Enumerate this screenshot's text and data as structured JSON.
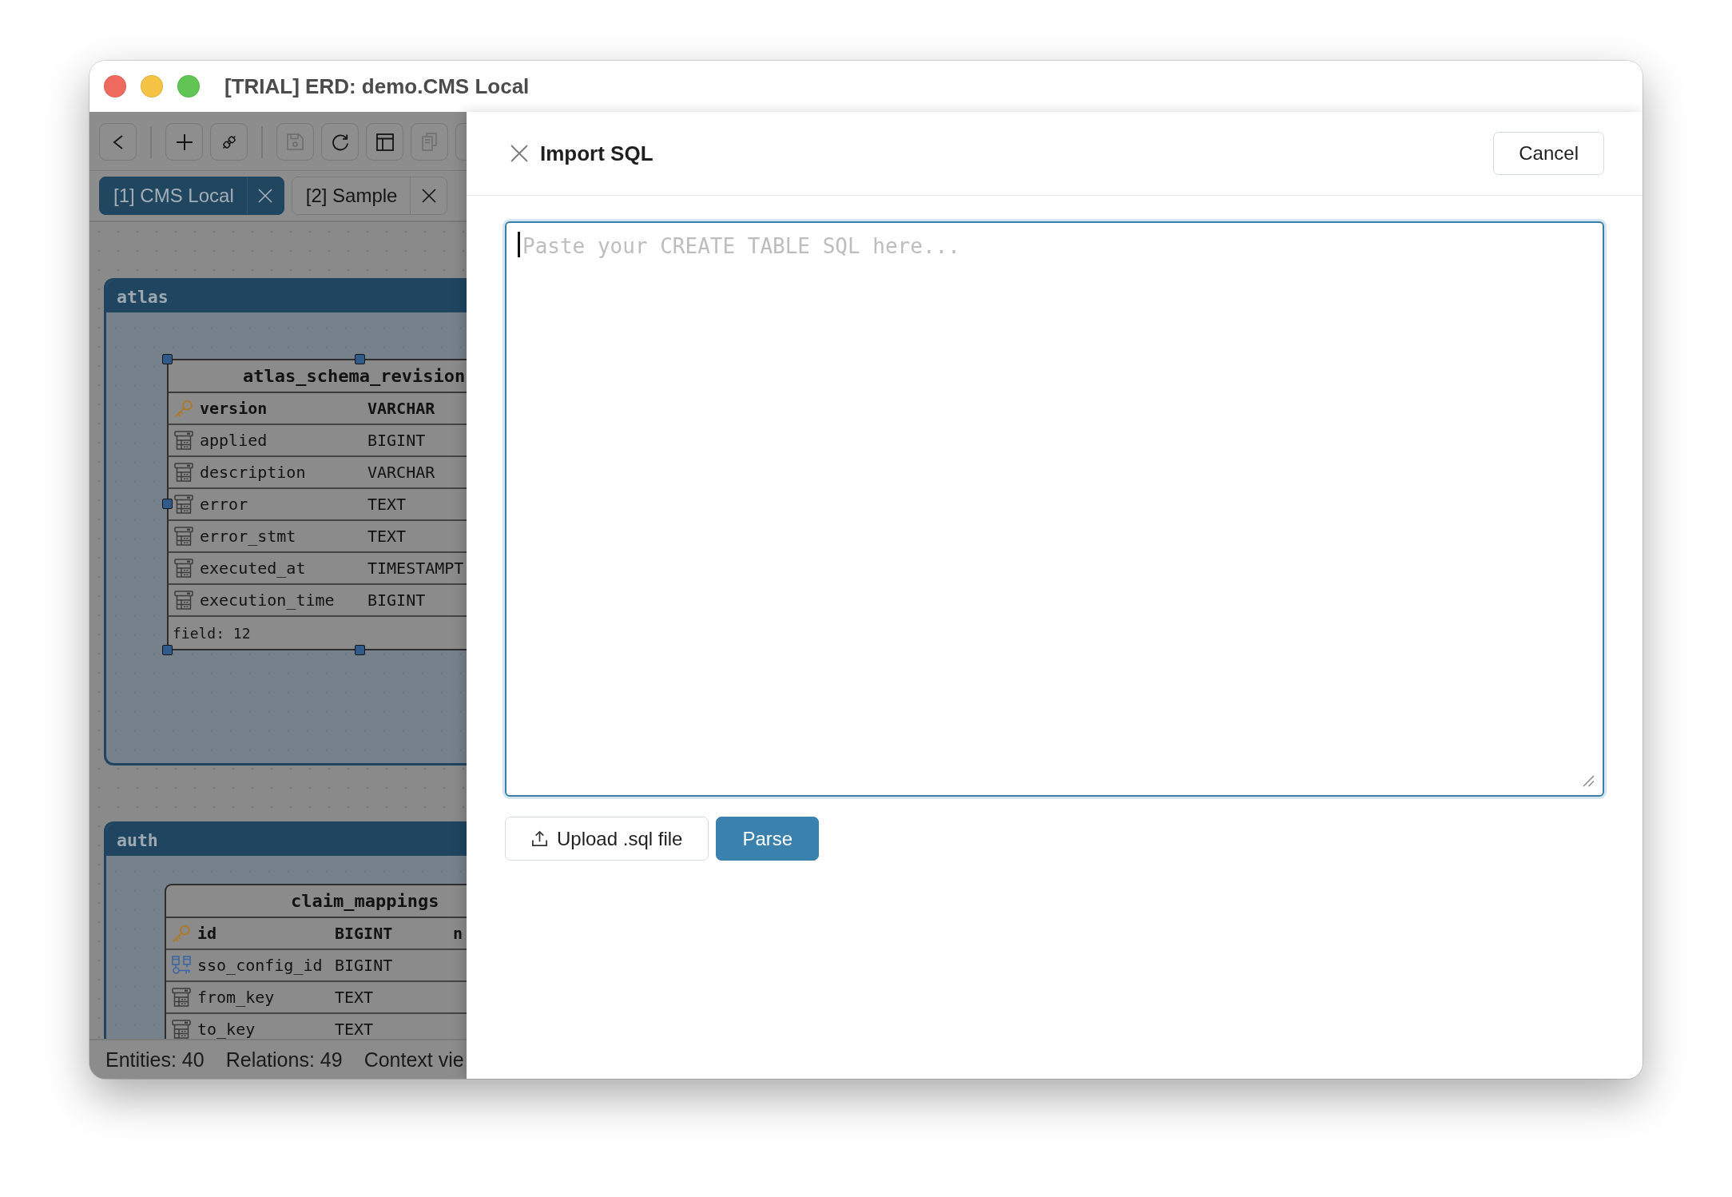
{
  "window": {
    "title": "[TRIAL] ERD: demo.CMS Local"
  },
  "toolbar": {
    "groups": [
      {
        "items": [
          {
            "kind": "back",
            "disabled": false
          }
        ]
      },
      {
        "items": [
          {
            "kind": "add",
            "disabled": false
          },
          {
            "kind": "connect",
            "disabled": false
          }
        ]
      },
      {
        "items": [
          {
            "kind": "save",
            "disabled": true
          },
          {
            "kind": "refresh",
            "disabled": false
          },
          {
            "kind": "layout",
            "disabled": false
          },
          {
            "kind": "copy",
            "disabled": true
          },
          {
            "kind": "clipped"
          }
        ]
      }
    ]
  },
  "tabs": [
    {
      "label": "[1] CMS Local",
      "selected": true
    },
    {
      "label": "[2] Sample",
      "selected": false
    }
  ],
  "canvas": {
    "groups": [
      {
        "name": "atlas",
        "tables": [
          {
            "name": "atlas_schema_revision",
            "selected": true,
            "columns": [
              {
                "kind": "key",
                "name": "version",
                "type": "VARCHAR"
              },
              {
                "kind": "column",
                "name": "applied",
                "type": "BIGINT"
              },
              {
                "kind": "column",
                "name": "description",
                "type": "VARCHAR"
              },
              {
                "kind": "column",
                "name": "error",
                "type": "TEXT"
              },
              {
                "kind": "column",
                "name": "error_stmt",
                "type": "TEXT"
              },
              {
                "kind": "column",
                "name": "executed_at",
                "type": "TIMESTAMPT"
              },
              {
                "kind": "column",
                "name": "execution_time",
                "type": "BIGINT"
              }
            ],
            "footer": "field: 12"
          }
        ]
      },
      {
        "name": "auth",
        "tables": [
          {
            "name": "claim_mappings",
            "selected": false,
            "columns": [
              {
                "kind": "key",
                "name": "id",
                "type": "BIGINT",
                "column_3": "n"
              },
              {
                "kind": "foreign_key",
                "name": "sso_config_id",
                "type": "BIGINT"
              },
              {
                "kind": "column",
                "name": "from_key",
                "type": "TEXT"
              },
              {
                "kind": "column",
                "name": "to_key",
                "type": "TEXT"
              }
            ]
          }
        ]
      }
    ]
  },
  "status_bar": {
    "items": [
      "Entities: 40",
      "Relations: 49",
      "Context vie"
    ]
  },
  "dialog": {
    "title": "Import SQL",
    "cancel_label": "Cancel",
    "sql_input": {
      "placeholder": "Paste your CREATE TABLE SQL here...",
      "focused": true
    },
    "actions": [
      {
        "kind": "upload",
        "label": "Upload .sql file"
      },
      {
        "kind": "primary",
        "label": "Parse"
      }
    ]
  }
}
